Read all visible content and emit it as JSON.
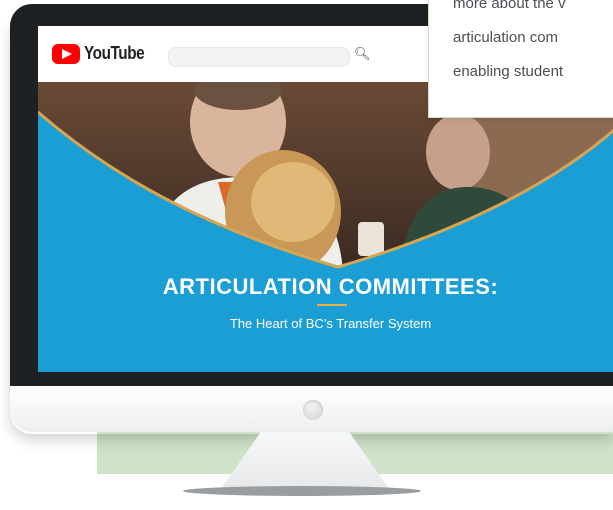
{
  "youtube": {
    "wordmark": "YouTube",
    "search_placeholder": ""
  },
  "video": {
    "title": "ARTICULATION COMMITTEES:",
    "subtitle": "The Heart of BC’s Transfer System"
  },
  "callout": {
    "lines": [
      "more about the v",
      "articulation com",
      "enabling student"
    ]
  },
  "colors": {
    "screen_blue": "#1b9ed4",
    "accent_gold": "#e8b14a",
    "youtube_red": "#ff0000",
    "background_green": "#cfe3c8",
    "bezel": "#1e2124"
  },
  "icons": [
    "youtube-play-icon",
    "search-icon"
  ]
}
